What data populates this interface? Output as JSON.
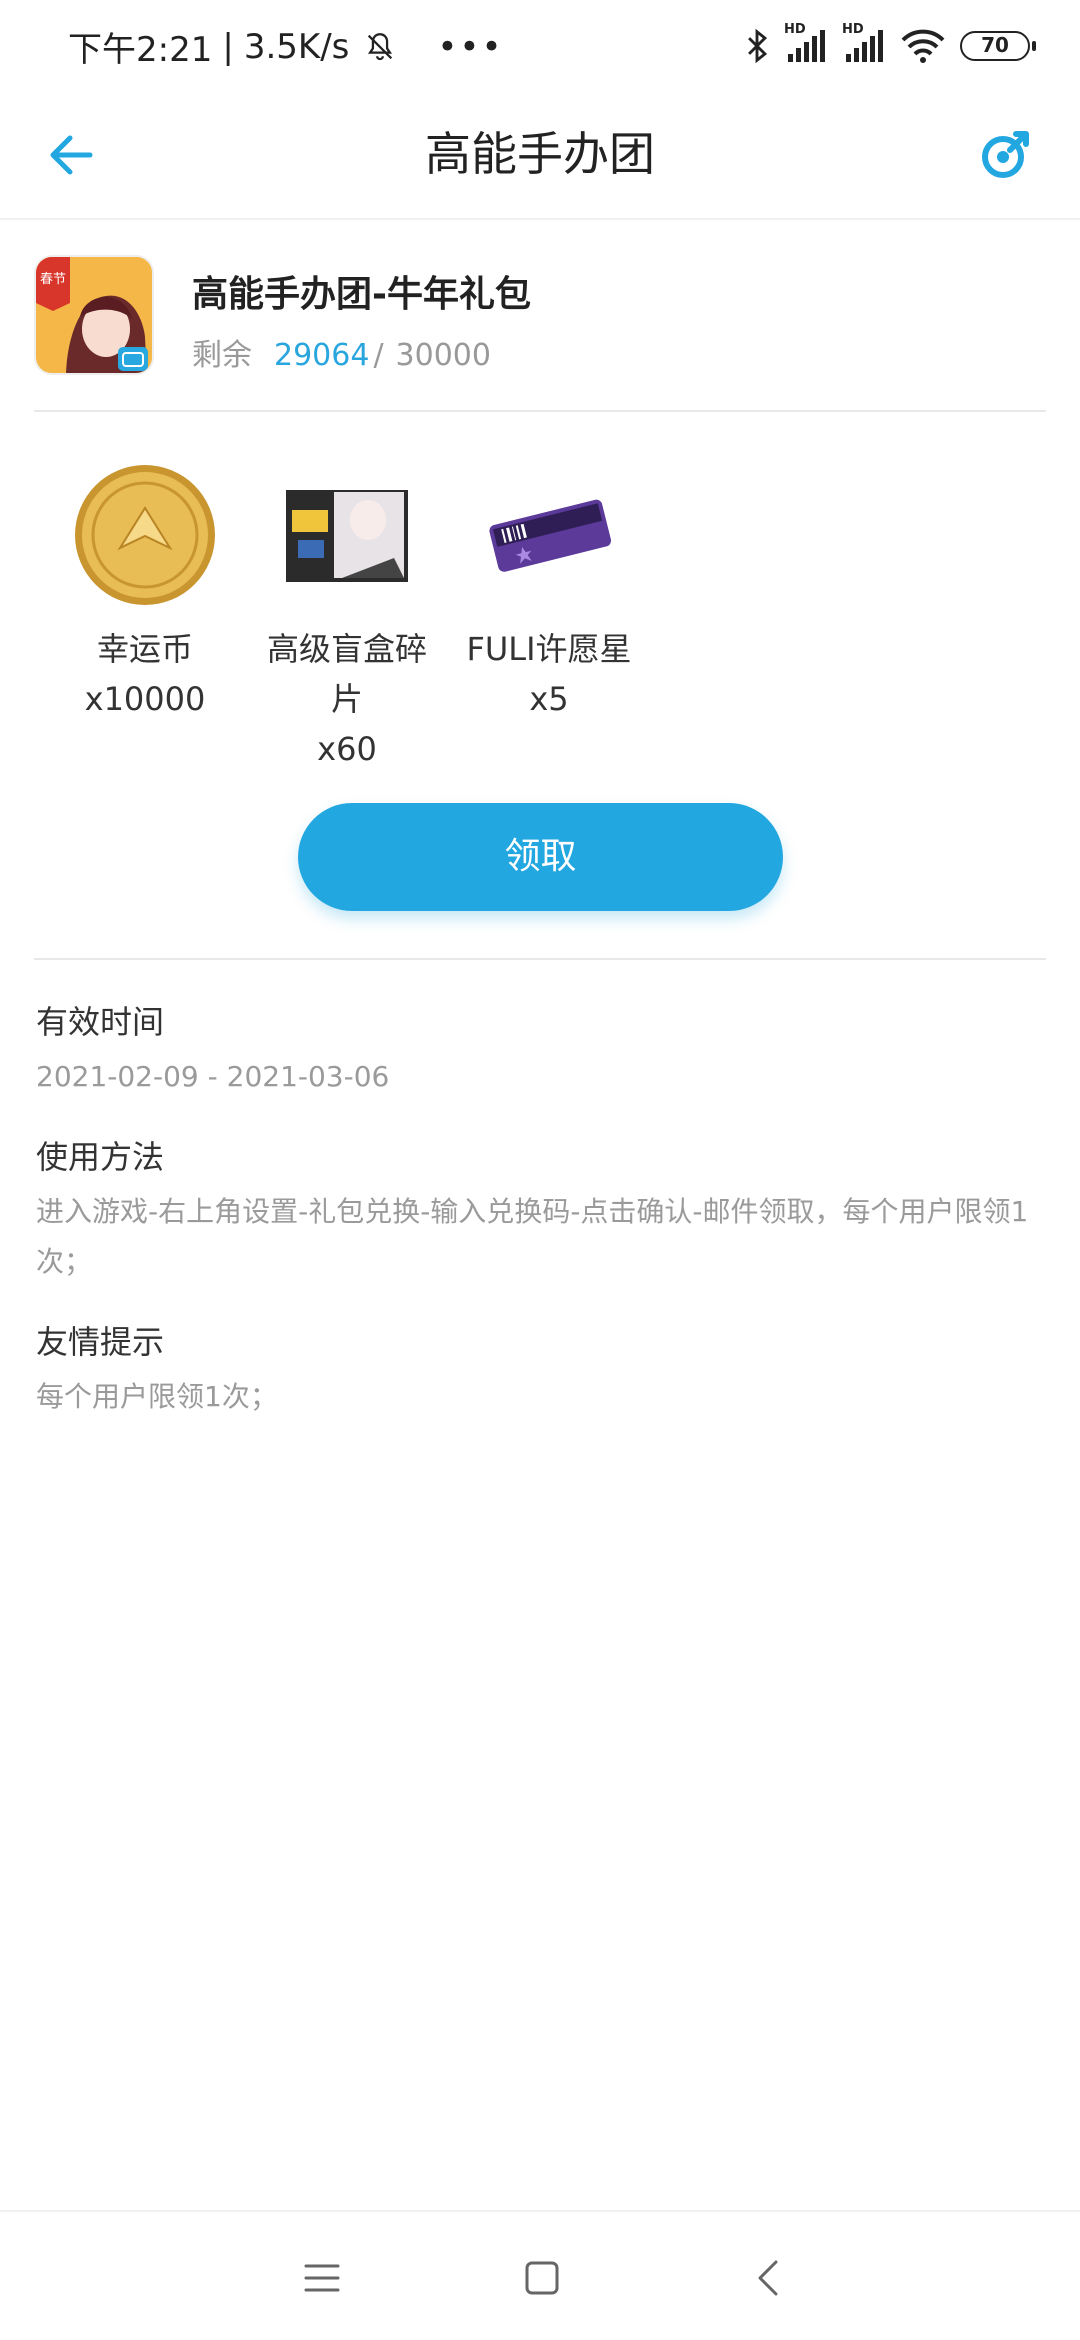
{
  "status_bar": {
    "time": "下午2:21",
    "speed": "3.5K/s",
    "network_label_1": "HD",
    "network_label_2": "HD",
    "battery": "70"
  },
  "header": {
    "title": "高能手办团"
  },
  "game": {
    "icon_tag": "春节",
    "title": "高能手办团-牛年礼包",
    "remain_label": "剩余",
    "remain_current": "29064",
    "remain_separator": "/",
    "remain_total": "30000"
  },
  "rewards": [
    {
      "name": "幸运币",
      "qty": "x10000"
    },
    {
      "name": "高级盲盒碎\n片",
      "qty": "x60"
    },
    {
      "name": "FULI许愿星",
      "qty": "x5"
    }
  ],
  "claim_button": "领取",
  "details": {
    "valid_label": "有效时间",
    "valid_value": "2021-02-09 - 2021-03-06",
    "usage_label": "使用方法",
    "usage_value": "进入游戏-右上角设置-礼包兑换-输入兑换码-点击确认-邮件领取，每个用户限领1次；",
    "tip_label": "友情提示",
    "tip_value": "每个用户限领1次；"
  },
  "colors": {
    "accent": "#22a7e0",
    "remain_current": "#2aa6df",
    "muted_text": "#9a9a9a"
  },
  "icons": [
    "bell-off-icon",
    "bluetooth-icon",
    "signal-icon",
    "wifi-icon",
    "battery-icon",
    "back-arrow-icon",
    "share-icon",
    "menu-icon",
    "home-icon",
    "back-nav-icon"
  ]
}
